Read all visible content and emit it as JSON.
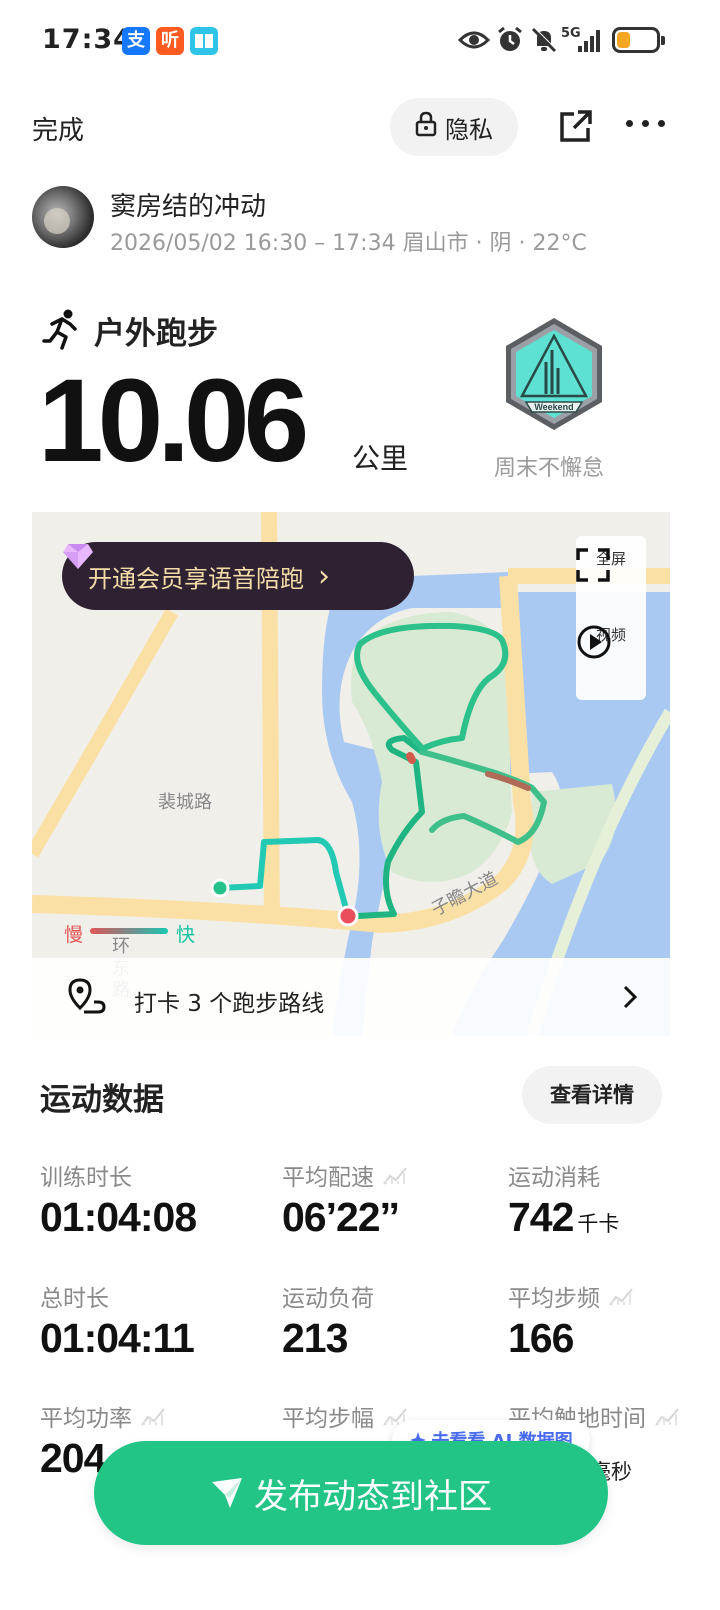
{
  "status_bar": {
    "time": "17:34",
    "apps": [
      "支",
      "听",
      "书"
    ],
    "network": "5G",
    "battery_level": 0.35
  },
  "top_bar": {
    "done_label": "完成",
    "privacy_label": "隐私"
  },
  "user": {
    "name": "窦房结的冲动",
    "meta": "2026/05/02 16:30 – 17:34 眉山市 · 阴 · 22°C"
  },
  "activity": {
    "type": "户外跑步",
    "distance": "10.06",
    "distance_unit": "公里",
    "badge_text": "Weekend",
    "badge_label": "周末不懈怠"
  },
  "map": {
    "vip_banner": "开通会员享语音陪跑",
    "vip_chevron": "›",
    "fullscreen_label": "全屏",
    "video_label": "视频",
    "road_labels": [
      "裴城路",
      "子瞻大道",
      "环东路"
    ],
    "legend_slow": "慢",
    "legend_fast": "快",
    "checkin_text": "打卡 3 个跑步路线",
    "colors": {
      "route": "#22c28a",
      "water": "#a9c9f2",
      "park": "#d8ead4",
      "road": "#fbe0a5"
    }
  },
  "stats": {
    "title": "运动数据",
    "details_label": "查看详情",
    "items": [
      {
        "label": "训练时长",
        "value": "01:04:08"
      },
      {
        "label": "平均配速",
        "value": "06’22’’"
      },
      {
        "label": "运动消耗",
        "value": "742",
        "unit": "千卡"
      },
      {
        "label": "总时长",
        "value": "01:04:11"
      },
      {
        "label": "运动负荷",
        "value": "213"
      },
      {
        "label": "平均步频",
        "value": "166"
      },
      {
        "label": "平均功率",
        "value": "204"
      },
      {
        "label": "平均步幅"
      },
      {
        "label": "平均触地时间",
        "unit": "毫秒"
      }
    ]
  },
  "ai_tag": "去看看 AI 数据图",
  "publish_label": "发布动态到社区",
  "accent_color": "#23c586"
}
